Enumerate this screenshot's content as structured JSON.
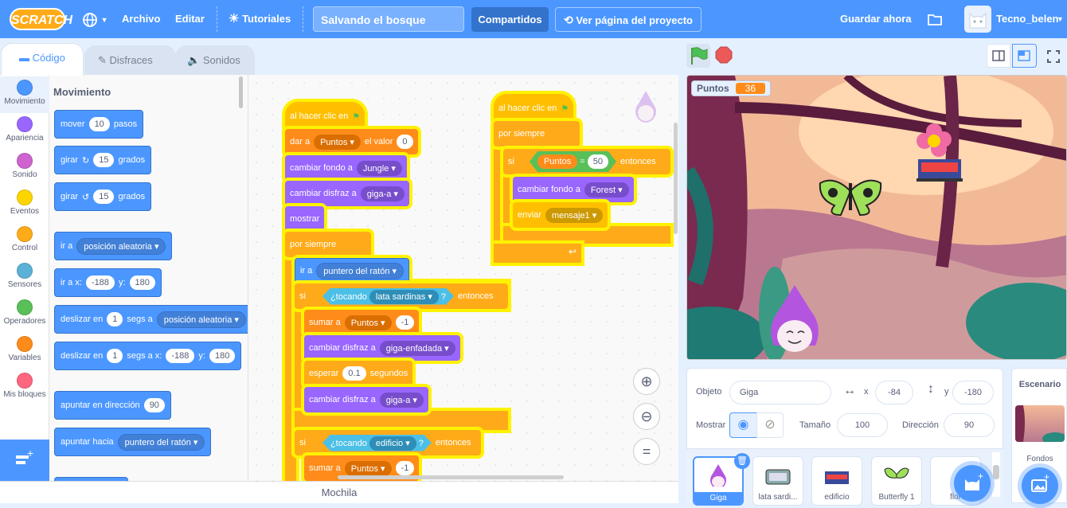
{
  "menubar": {
    "logo": "SCRATCH",
    "archivo": "Archivo",
    "editar": "Editar",
    "tutoriales": "Tutoriales",
    "project_title": "Salvando el bosque",
    "compartidos": "Compartidos",
    "ver_pagina": "Ver página del proyecto",
    "guardar": "Guardar ahora",
    "username": "Tecno_belen"
  },
  "tabs": {
    "codigo": "Código",
    "disfraces": "Disfraces",
    "sonidos": "Sonidos"
  },
  "categories": [
    "Movimiento",
    "Apariencia",
    "Sonido",
    "Eventos",
    "Control",
    "Sensores",
    "Operadores",
    "Variables",
    "Mis bloques"
  ],
  "category_colors": [
    "#4c97ff",
    "#9966ff",
    "#cf63cf",
    "#ffd500",
    "#ffab19",
    "#5cb1d6",
    "#59c059",
    "#ff8c1a",
    "#ff6680"
  ],
  "palette": {
    "heading": "Movimiento",
    "mover": "mover",
    "mover_val": "10",
    "pasos": "pasos",
    "girar": "girar",
    "girar_val": "15",
    "grados": "grados",
    "ir_a": "ir a",
    "posicion_aleatoria": "posición aleatoria",
    "ir_a_x": "ir a x:",
    "x_val": "-188",
    "y_lbl": "y:",
    "y_val": "180",
    "deslizar": "deslizar en",
    "segs_val": "1",
    "segs_a": "segs a",
    "segs_a_x": "segs a x:",
    "apuntar_dir": "apuntar en dirección",
    "dir_val": "90",
    "apuntar_hacia": "apuntar hacia",
    "puntero": "puntero del ratón"
  },
  "script1": {
    "hat": "al hacer clic en",
    "dar_a": "dar a",
    "var_puntos": "Puntos",
    "el_valor": "el valor",
    "val0": "0",
    "cambiar_fondo": "cambiar fondo a",
    "jungle": "Jungle",
    "cambiar_disfraz": "cambiar disfraz a",
    "giga_a": "giga-a",
    "mostrar": "mostrar",
    "por_siempre": "por siempre",
    "ir_a": "ir a",
    "puntero": "puntero del ratón",
    "si": "si",
    "tocando": "¿tocando",
    "lata": "lata sardinas",
    "q": "?",
    "entonces": "entonces",
    "sumar_a": "sumar a",
    "menos1": "-1",
    "giga_enfadada": "giga-enfadada",
    "esperar": "esperar",
    "wait_val": "0.1",
    "segundos": "segundos",
    "edificio": "edificio"
  },
  "script2": {
    "hat": "al hacer clic en",
    "por_siempre": "por siempre",
    "si": "si",
    "puntos": "Puntos",
    "eq": "=",
    "val50": "50",
    "entonces": "entonces",
    "cambiar_fondo": "cambiar fondo a",
    "forest": "Forest",
    "enviar": "enviar",
    "mensaje1": "mensaje1"
  },
  "monitor": {
    "label": "Puntos",
    "value": "36"
  },
  "sprite_info": {
    "objeto_lbl": "Objeto",
    "objeto": "Giga",
    "x_lbl": "x",
    "x": "-84",
    "y_lbl": "y",
    "y": "-180",
    "mostrar_lbl": "Mostrar",
    "tamano_lbl": "Tamaño",
    "tamano": "100",
    "direccion_lbl": "Dirección",
    "direccion": "90"
  },
  "sprites": [
    "Giga",
    "lata sardi...",
    "edificio",
    "Butterfly 1",
    "flor"
  ],
  "stage_panel": {
    "title": "Escenario",
    "fondos": "Fondos"
  },
  "mochila": "Mochila"
}
